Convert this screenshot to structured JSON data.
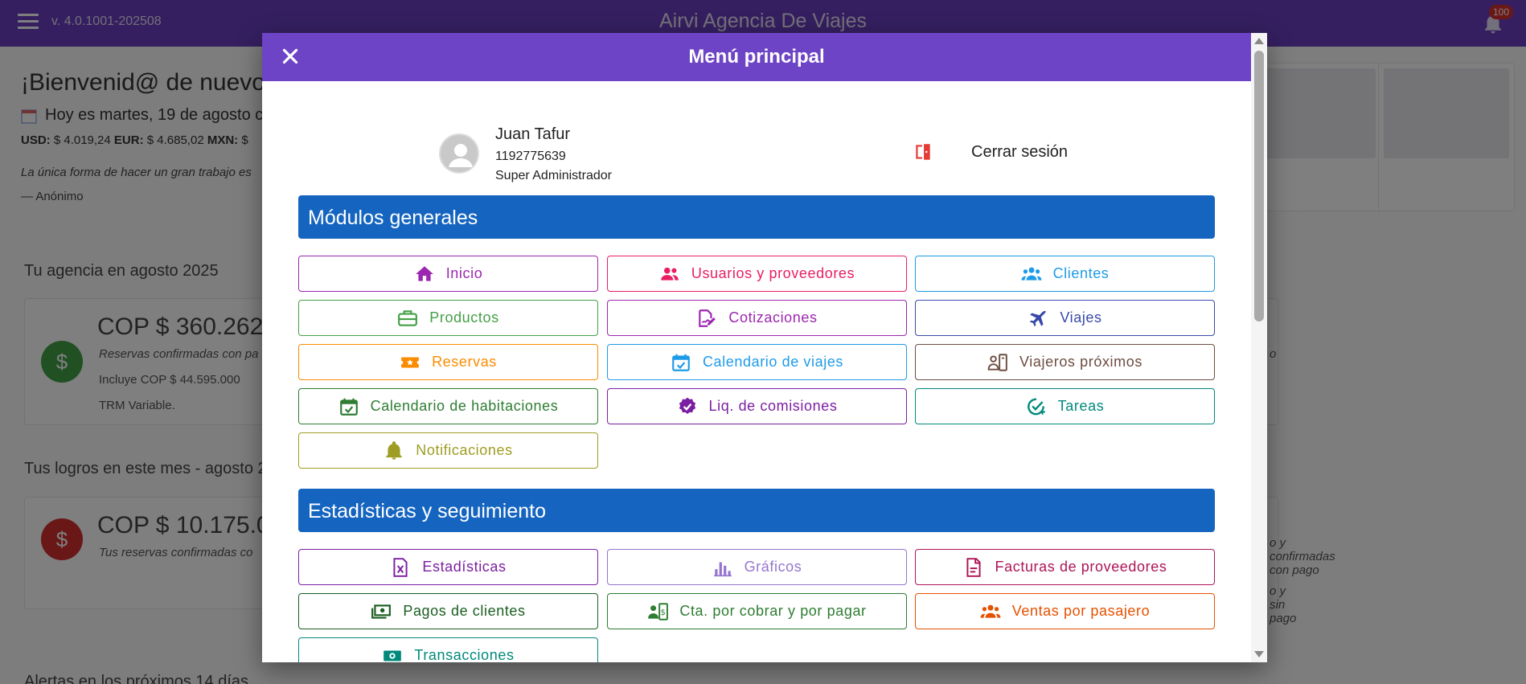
{
  "appbar": {
    "version": "v. 4.0.1001-202508",
    "brand": "Airvi Agencia De Viajes",
    "notification_count": "100"
  },
  "background": {
    "welcome": "¡Bienvenid@ de nuevo",
    "today": "Hoy es martes, 19 de agosto c",
    "rates": [
      {
        "label": "USD:",
        "value": "$ 4.019,24"
      },
      {
        "label": "EUR:",
        "value": "$ 4.685,02"
      },
      {
        "label": "MXN:",
        "value": "$"
      }
    ],
    "quote": "La única forma de hacer un gran trabajo es",
    "author": "— Anónimo",
    "agency_title": "Tu agencia en agosto 2025",
    "agency_amount": "COP $ 360.262",
    "agency_desc": "Reservas confirmadas con pa",
    "agency_note": "Incluye COP $ 44.595.000",
    "agency_trm": "TRM Variable.",
    "agency_right": "o",
    "achievements_title": "Tus logros en este mes - agosto 2",
    "achv_amount": "COP $ 10.175.0",
    "achv_desc": "Tus reservas confirmadas co",
    "achv_right1": "o y confirmadas con pago",
    "achv_right2": "o y sin pago",
    "alerts_title": "Alertas en los próximos 14 días"
  },
  "modal": {
    "title": "Menú principal",
    "close_label": "×",
    "user": {
      "name": "Juan Tafur",
      "id": "1192775639",
      "role": "Super Administrador"
    },
    "logout_label": "Cerrar sesión",
    "section_general": "Módulos generales",
    "section_stats": "Estadísticas y seguimiento",
    "general": [
      {
        "label": "Inicio",
        "color": "#9c27b0",
        "icon": "home-icon"
      },
      {
        "label": "Usuarios y proveedores",
        "color": "#e91e63",
        "icon": "users-icon"
      },
      {
        "label": "Clientes",
        "color": "#1e9be8",
        "icon": "group-icon"
      },
      {
        "label": "Productos",
        "color": "#43a047",
        "icon": "briefcase-icon"
      },
      {
        "label": "Cotizaciones",
        "color": "#9c27b0",
        "icon": "signature-icon"
      },
      {
        "label": "Viajes",
        "color": "#3949ab",
        "icon": "plane-icon"
      },
      {
        "label": "Reservas",
        "color": "#fb8c00",
        "icon": "ticket-icon"
      },
      {
        "label": "Calendario de viajes",
        "color": "#1e9be8",
        "icon": "calendar-check-icon"
      },
      {
        "label": "Viajeros próximos",
        "color": "#6d4c41",
        "icon": "id-card-icon"
      },
      {
        "label": "Calendario de habitaciones",
        "color": "#2e7d32",
        "icon": "calendar-check-icon"
      },
      {
        "label": "Liq. de comisiones",
        "color": "#7b1fa2",
        "icon": "verified-icon"
      },
      {
        "label": "Tareas",
        "color": "#00897b",
        "icon": "task-check-icon"
      },
      {
        "label": "Notificaciones",
        "color": "#9e9d24",
        "icon": "bell-icon"
      }
    ],
    "stats": [
      {
        "label": "Estadísticas",
        "color": "#7b1fa2",
        "icon": "spreadsheet-icon"
      },
      {
        "label": "Gráficos",
        "color": "#9575cd",
        "icon": "bar-chart-icon"
      },
      {
        "label": "Facturas de proveedores",
        "color": "#ad1457",
        "icon": "document-icon"
      },
      {
        "label": "Pagos de clientes",
        "color": "#1b5e20",
        "icon": "money-icon"
      },
      {
        "label": "Cta. por cobrar y por pagar",
        "color": "#2e7d32",
        "icon": "contact-money-icon"
      },
      {
        "label": "Ventas por pasajero",
        "color": "#e65100",
        "icon": "group-icon"
      },
      {
        "label": "Transacciones",
        "color": "#00897b",
        "icon": "cash-icon"
      }
    ]
  }
}
